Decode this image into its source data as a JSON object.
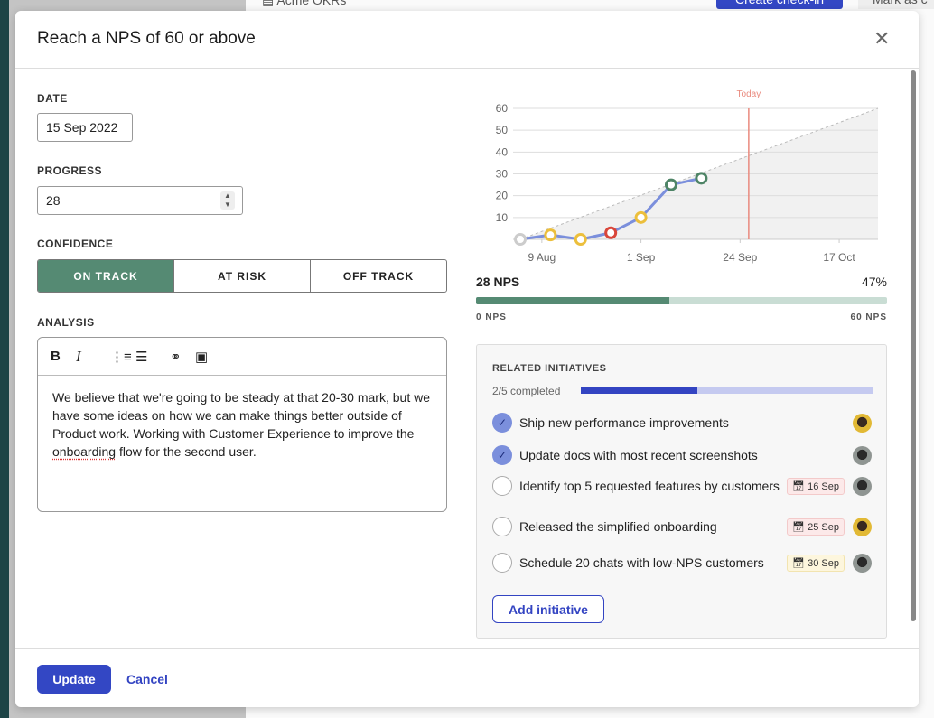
{
  "background": {
    "breadcrumb": "Acme OKRs",
    "create_checkin": "Create check-in",
    "mark_as": "Mark as c"
  },
  "modal": {
    "title": "Reach a NPS of 60 or above",
    "close_icon": "close-icon",
    "date": {
      "label": "DATE",
      "value": "15 Sep 2022"
    },
    "progress": {
      "label": "PROGRESS",
      "value": "28"
    },
    "confidence": {
      "label": "CONFIDENCE",
      "options": [
        "ON TRACK",
        "AT RISK",
        "OFF TRACK"
      ],
      "selected": "ON TRACK"
    },
    "analysis": {
      "label": "ANALYSIS",
      "toolbar": [
        "bold-icon",
        "italic-icon",
        "ordered-list-icon",
        "bullet-list-icon",
        "link-icon",
        "image-icon"
      ],
      "text_before": "We believe that we're going to be steady at that 20-30 mark, but we have some ideas on how we can make things better outside of Product work. Working with Customer Experience to improve the ",
      "text_misspelled": "onboarding",
      "text_after": " flow for the second user."
    },
    "metric": {
      "value_label": "28 NPS",
      "percent_label": "47%",
      "percent": 47,
      "min_label": "0 NPS",
      "max_label": "60 NPS",
      "color": "#558a73"
    },
    "related": {
      "heading": "RELATED INITIATIVES",
      "completed_label": "2/5 completed",
      "completed_fraction": 0.4,
      "items": [
        {
          "text": "Ship new performance improvements",
          "done": true,
          "due": "",
          "avatar": "yellow"
        },
        {
          "text": "Update docs with most recent screenshots",
          "done": true,
          "due": "",
          "avatar": "gray"
        },
        {
          "text": "Identify top 5 requested features by customers",
          "done": false,
          "due": "16 Sep",
          "due_status": "red",
          "avatar": "gray"
        },
        {
          "text": "Released the simplified onboarding",
          "done": false,
          "due": "25 Sep",
          "due_status": "red",
          "avatar": "yellow"
        },
        {
          "text": "Schedule 20 chats with low-NPS customers",
          "done": false,
          "due": "30 Sep",
          "due_status": "yellow",
          "avatar": "gray"
        }
      ],
      "add_label": "Add initiative"
    },
    "footer": {
      "update": "Update",
      "cancel": "Cancel"
    }
  },
  "chart_data": {
    "type": "line",
    "x": [
      "2022-08-04",
      "2022-08-11",
      "2022-08-18",
      "2022-08-25",
      "2022-09-01",
      "2022-09-08",
      "2022-09-15"
    ],
    "values": [
      0,
      2,
      0,
      3,
      10,
      25,
      28
    ],
    "point_status": [
      "none",
      "at-risk",
      "at-risk",
      "off-track",
      "at-risk",
      "on-track",
      "on-track"
    ],
    "status_colors": {
      "none": "#cccccc",
      "at-risk": "#ecbf3c",
      "off-track": "#d9463a",
      "on-track": "#4e8466"
    },
    "target_line": {
      "from": [
        "2022-08-04",
        0
      ],
      "to": [
        "2022-10-26",
        60
      ]
    },
    "today": {
      "label": "Today",
      "date": "2022-09-26",
      "color": "#e98a7e"
    },
    "xticks": [
      {
        "label": "9 Aug",
        "date": "2022-08-09"
      },
      {
        "label": "1 Sep",
        "date": "2022-09-01"
      },
      {
        "label": "24 Sep",
        "date": "2022-09-24"
      },
      {
        "label": "17 Oct",
        "date": "2022-10-17"
      }
    ],
    "yticks": [
      10,
      20,
      30,
      40,
      50,
      60
    ],
    "ylim": [
      0,
      60
    ],
    "xlim": [
      "2022-08-04",
      "2022-10-26"
    ],
    "line_color": "#7b8fdc",
    "grid": true
  }
}
